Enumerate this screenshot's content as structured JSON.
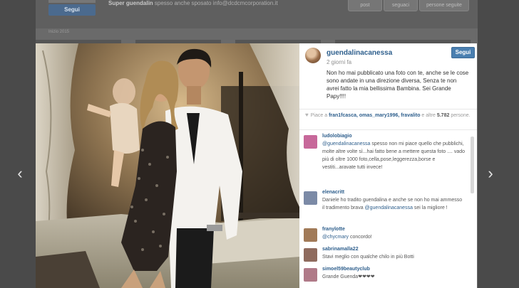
{
  "background": {
    "follow_label": "Segui",
    "userline_name": "Super guendalin",
    "userline_rest": " spesso anche sposato info@dcdcmcorporation.it",
    "stats": [
      "post",
      "seguaci",
      "persone seguite"
    ],
    "date_label": "Inizio 2015"
  },
  "nav": {
    "prev": "‹",
    "next": "›"
  },
  "post": {
    "username": "guendalinacanessa",
    "time": "2 giorni fa",
    "follow_label": "Segui",
    "caption": "Non ho mai pubblicato una foto con te, anche se le cose sono andate in una direzione diversa, Senza te non avrei fatto la mia bellissima Bambina. Sei Grande Papy!!!!",
    "likes_prefix": "Piace a",
    "likers": "fran1fcasca, omas_mary1996, fravalito",
    "likes_middle": " e altre",
    "likes_count": "5.782",
    "likes_suffix": " persone."
  },
  "comments": [
    {
      "user": "ludolobiagio",
      "text_mention": "@guendalinacanessa",
      "text": " spesso non mi piace quello che pubblichi, molte altre volte sì...hai fatto bene a mettere questa foto .... vado più di oltre 1000 foto,cella,pose,leggerezza,borse e vestiti...aravate tutti invece!",
      "color": "#c7689a"
    },
    {
      "user": "elenacritt",
      "text": "Daniele ho tradito guendalina e anche se non ho mai ammesso il tradimento brava ",
      "text_mention_end": "@guendalinacanessa",
      "text_end": " sei la migliore !",
      "color": "#7b8aa6"
    },
    {
      "user": "franylotte",
      "text_mention": "@chycmary",
      "text": " concordo!",
      "color": "#a17a58"
    },
    {
      "user": "sabrinamalla22",
      "text": "Stavi meglio con qualche chilo in più Botti",
      "color": "#8f6b5e"
    },
    {
      "user": "simoel59beautyclub",
      "text": "Grande Guenda❤❤❤❤",
      "color": "#b07a88"
    }
  ],
  "colors": {
    "accent": "#2d5e8c",
    "follow_button": "#4a7fb0",
    "overlay": "#4a4a4a"
  },
  "icons": {
    "heart": "♥"
  }
}
